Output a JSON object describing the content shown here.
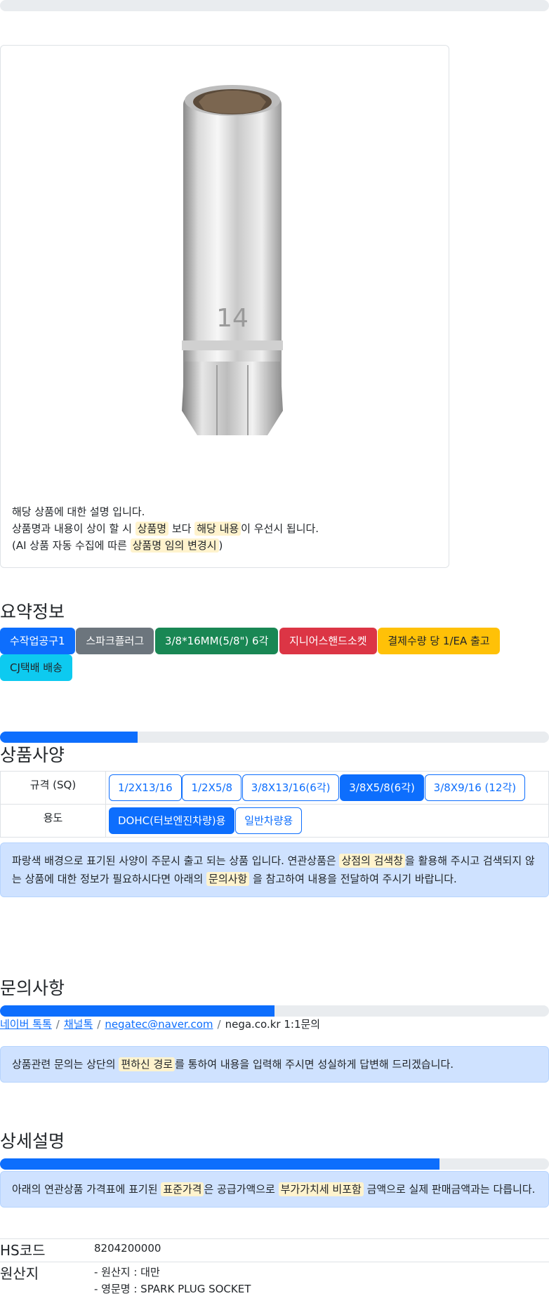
{
  "product_card": {
    "line1": "해당 상품에 대한 설명 입니다.",
    "line2_pre": "상품명과 내용이 상이 할 시 ",
    "line2_hl1": "상품명",
    "line2_mid": " 보다 ",
    "line2_hl2": "해당 내용",
    "line2_post": "이 우선시 됩니다.",
    "line3_pre": "(AI 상품 자동 수집에 따른 ",
    "line3_hl": "상품명 임의 변경시",
    "line3_post": ")"
  },
  "summary": {
    "title": "요약정보",
    "badges": [
      {
        "label": "수작업공구1",
        "color": "#0d6efd"
      },
      {
        "label": "스파크플러그",
        "color": "#6c757d"
      },
      {
        "label": "3/8*16MM(5/8\") 6각",
        "color": "#198754"
      },
      {
        "label": "지니어스핸드소켓",
        "color": "#dc3545"
      },
      {
        "label": "결제수량 당 1/EA 출고",
        "color": "#ffc107"
      },
      {
        "label": "CJ택배 배송",
        "color": "#0dcaf0"
      }
    ]
  },
  "spec": {
    "title": "상품사양",
    "progress": 0.25,
    "rows": [
      {
        "label": "규격 (SQ)",
        "options": [
          "1/2X13/16",
          "1/2X5/8",
          "3/8X13/16(6각)",
          "3/8X5/8(6각)",
          "3/8X9/16 (12각)"
        ],
        "selected": "3/8X5/8(6각)"
      },
      {
        "label": "용도",
        "options": [
          "DOHC(터보엔진차량)용",
          "일반차량용"
        ],
        "selected": "DOHC(터보엔진차량)용"
      }
    ],
    "notice_pre": "파랑색 배경으로 표기된 사양이 주문시 출고 되는 상품 입니다. 연관상품은 ",
    "notice_hl1": "상점의 검색창",
    "notice_mid": "을 활용해 주시고 검색되지 않는 상품에 대한 정보가 필요하시다면 아래의 ",
    "notice_hl2": "문의사항",
    "notice_post": " 을 참고하여 내용을 전달하여 주시기 바랍니다."
  },
  "inquiry": {
    "title": "문의사항",
    "progress": 0.5,
    "links": [
      "네이버 톡톡",
      "채널톡",
      "negatec@naver.com"
    ],
    "plain": "nega.co.kr 1:1문의",
    "notice_pre": "상품관련 문의는 상단의 ",
    "notice_hl": "편하신 경로",
    "notice_post": "를 통하여 내용을 입력해 주시면 성실하게 답변해 드리겠습니다."
  },
  "detail": {
    "title": "상세설명",
    "progress": 0.8,
    "notice_pre": "아래의 연관상품 가격표에 표기된 ",
    "notice_hl1": "표준가격",
    "notice_mid": "은 공급가액으로 ",
    "notice_hl2": "부가가치세 비포함",
    "notice_post": " 금액으로 실제 판매금액과는 다릅니다.",
    "hs_label": "HS코드",
    "hs_value": "8204200000",
    "origin_label": "원산지",
    "origin_line1": "- 원산지 : 대만",
    "origin_line2": "- 영문명 : SPARK PLUG SOCKET"
  }
}
